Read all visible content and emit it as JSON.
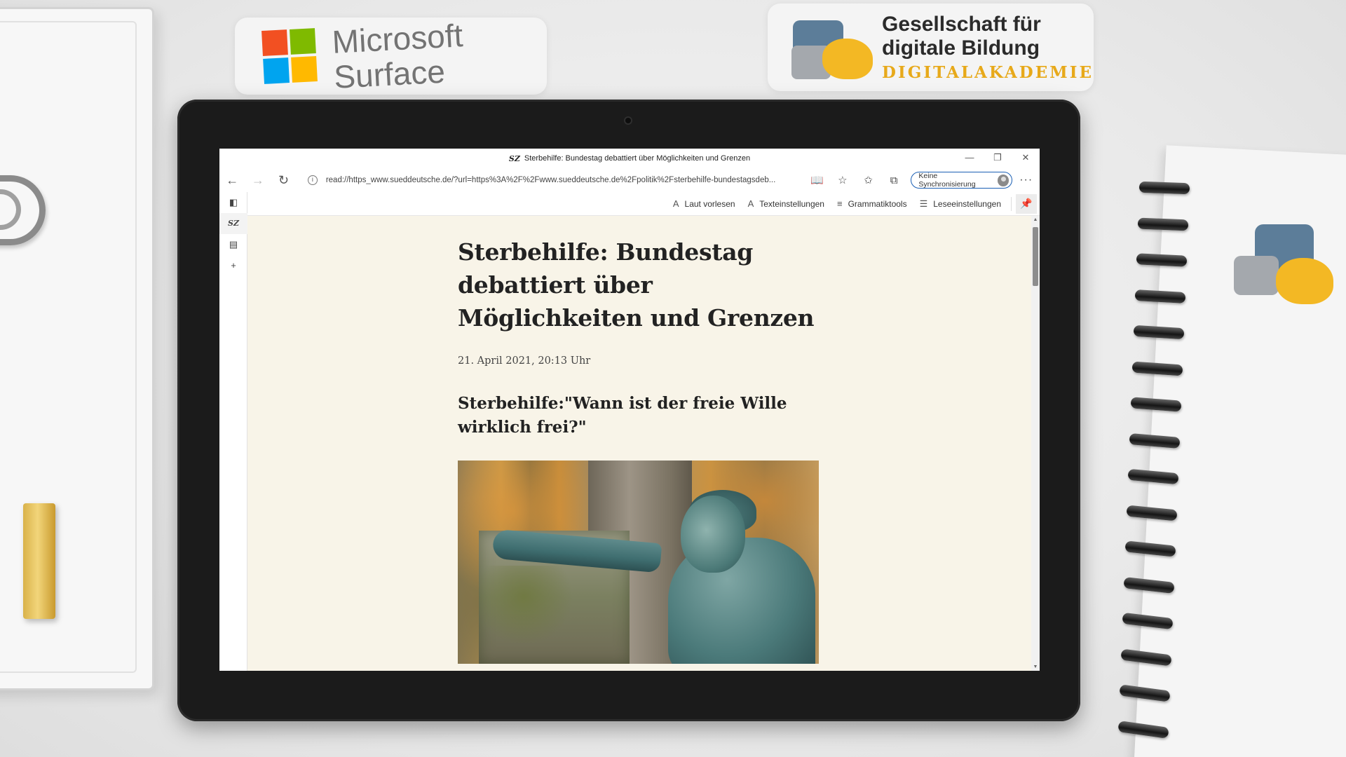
{
  "branding": {
    "microsoft": {
      "line1": "Microsoft",
      "line2": "Surface",
      "colors": [
        "#f25022",
        "#7fba00",
        "#00a4ef",
        "#ffb900"
      ]
    },
    "gdb": {
      "line1": "Gesellschaft für",
      "line2": "digitale Bildung",
      "sub": "DIGITALAKADEMIE"
    }
  },
  "browser": {
    "window_title": "Sterbehilfe: Bundestag debattiert über Möglichkeiten und Grenzen",
    "tab_favicon": "SZ",
    "window_controls": {
      "minimize": "—",
      "restore": "❐",
      "close": "✕"
    },
    "nav": {
      "back": "←",
      "forward": "→",
      "refresh": "↻"
    },
    "address": {
      "info_icon": "i",
      "url": "read://https_www.sueddeutsche.de/?url=https%3A%2F%2Fwww.sueddeutsche.de%2Fpolitik%2Fsterbehilfe-bundestagsdeb..."
    },
    "toolbar_icons": {
      "reader": "📖",
      "add_favorite": "☆",
      "favorites": "✩",
      "collections": "⧉"
    },
    "sync_label": "Keine Synchronisierung",
    "more": "···",
    "sidebar": {
      "panel": "◧",
      "sz": "SZ",
      "tabs": "▤",
      "add": "+"
    },
    "reader_toolbar": {
      "read_aloud": {
        "icon": "A",
        "label": "Laut vorlesen"
      },
      "text_settings": {
        "icon": "A",
        "label": "Texteinstellungen"
      },
      "grammar": {
        "icon": "≡",
        "label": "Grammatiktools"
      },
      "reading_prefs": {
        "icon": "☰",
        "label": "Leseeinstellungen"
      },
      "pin": "📌"
    }
  },
  "article": {
    "headline": "Sterbehilfe: Bundestag debattiert über Möglichkeiten und Grenzen",
    "date": "21. April 2021, 20:13 Uhr",
    "subheadline": "Sterbehilfe:\"Wann ist der freie Wille wirklich frei?\"",
    "reader_background": "#f8f4e8"
  }
}
